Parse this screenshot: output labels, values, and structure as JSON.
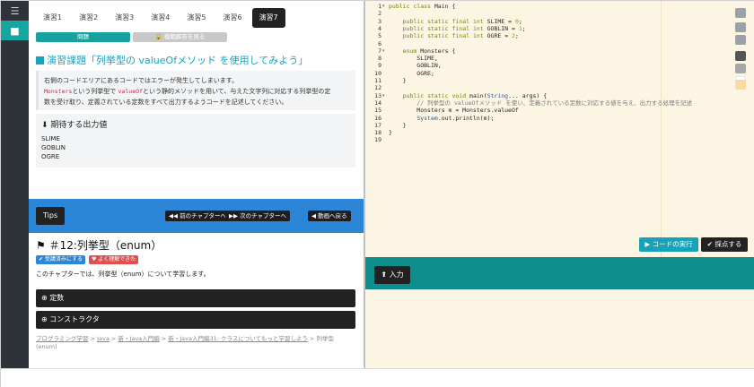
{
  "rail": {
    "items": [
      {
        "icon": "menu-icon"
      },
      {
        "icon": "video-icon"
      }
    ]
  },
  "tabs": [
    "演習1",
    "演習2",
    "演習3",
    "演習4",
    "演習5",
    "演習6",
    "演習7"
  ],
  "active_tab": "演習7",
  "subtabs": {
    "problem": "問題",
    "answer": "🔒 模範解答を見る"
  },
  "exercise": {
    "title": "演習課題「列挙型の valueOfメソッド を使用してみよう」",
    "desc_line1": "右側のコードエリアにあるコードではエラーが発生してしまいます。",
    "desc_line2_code1": "Monsters",
    "desc_line2_mid": "という列挙型で",
    "desc_line2_code2": "valueOf",
    "desc_line2_end": "という静的メソッドを用いて、与えた文字列に対応する列挙型の定",
    "desc_line3": "数を受け取り、定義されている定数をすべて出力するようコードを記述してください。"
  },
  "expected": {
    "heading": "期待する出力値",
    "lines": [
      "SLIME",
      "GOBLIN",
      "OGRE"
    ]
  },
  "tips_bar": {
    "tips": "Tips",
    "prev": "◀◀ 前のチャプターへ",
    "next": "▶▶ 次のチャプターへ",
    "back": "◀ 動画へ戻る"
  },
  "chapter": {
    "title": "＃12:列挙型（enum）",
    "badge_read": "✔ 受講済みにする",
    "badge_understood": "♥ よく理解できた",
    "intro": "このチャプターでは、列挙型（enum）について学習します。"
  },
  "accordion": [
    {
      "label": "定数"
    },
    {
      "label": "コンストラクタ"
    }
  ],
  "breadcrumb": {
    "items": [
      "プログラミング学習",
      "Java",
      "新・Java入門編",
      "新・Java入門編31: クラスについてもっと学習しよう"
    ],
    "sep": " > ",
    "current": "列挙型(enum)"
  },
  "editor": {
    "lines": [
      {
        "n": "1",
        "fold": true,
        "text": "public class Main {"
      },
      {
        "n": "2",
        "fold": false,
        "text": ""
      },
      {
        "n": "3",
        "fold": false,
        "text": "    public static final int SLIME = 0;"
      },
      {
        "n": "4",
        "fold": false,
        "text": "    public static final int GOBLIN = 1;"
      },
      {
        "n": "5",
        "fold": false,
        "text": "    public static final int OGRE = 2;"
      },
      {
        "n": "6",
        "fold": false,
        "text": ""
      },
      {
        "n": "7",
        "fold": true,
        "text": "    enum Monsters {"
      },
      {
        "n": "8",
        "fold": false,
        "text": "        SLIME,"
      },
      {
        "n": "9",
        "fold": false,
        "text": "        GOBLIN,"
      },
      {
        "n": "10",
        "fold": false,
        "text": "        OGRE;"
      },
      {
        "n": "11",
        "fold": false,
        "text": "    }"
      },
      {
        "n": "12",
        "fold": false,
        "text": ""
      },
      {
        "n": "13",
        "fold": true,
        "text": "    public static void main(String... args) {"
      },
      {
        "n": "14",
        "fold": false,
        "text": "        // 列挙型の valueOfメソッド を使い、定義されている定数に対応する値を与え、出力する処理を記述"
      },
      {
        "n": "15",
        "fold": false,
        "text": "        Monsters m = Monsters.valueOf"
      },
      {
        "n": "16",
        "fold": false,
        "text": "        System.out.println(m);"
      },
      {
        "n": "17",
        "fold": false,
        "text": "    }"
      },
      {
        "n": "18",
        "fold": false,
        "text": "}"
      },
      {
        "n": "19",
        "fold": false,
        "text": ""
      }
    ],
    "side_tools": [
      "refresh-icon",
      "zoom-in-icon",
      "zoom-out-icon",
      "theme-dark-swatch",
      "theme-gray-swatch",
      "theme-light-swatch",
      "theme-cream-swatch"
    ]
  },
  "actions": {
    "run": "▶ コードの実行",
    "grade": "✔ 採点する"
  },
  "input": {
    "label": "⬆ 入力"
  }
}
